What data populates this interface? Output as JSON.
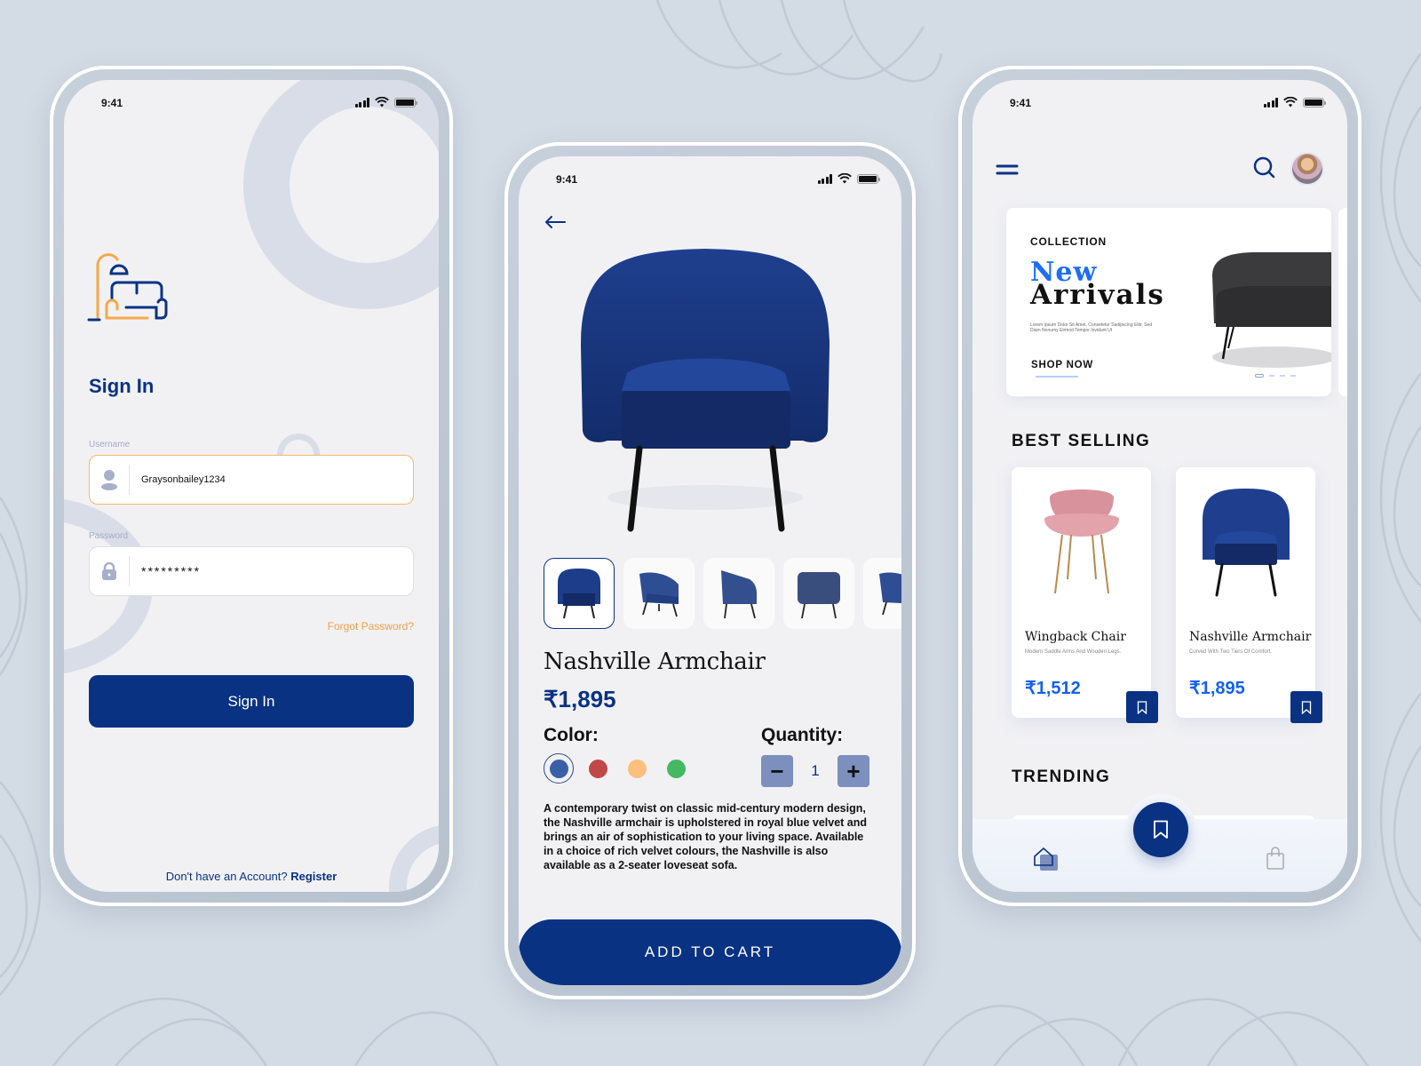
{
  "status_bar": {
    "time": "9:41"
  },
  "signin_screen": {
    "title": "Sign In",
    "username": {
      "label": "Username",
      "value": "Graysonbailey1234",
      "icon": "user-icon"
    },
    "password": {
      "label": "Password",
      "value": "*********",
      "icon": "lock-icon"
    },
    "forgot_password": "Forgot Password?",
    "signin_button": "Sign In",
    "register_prompt": "Don't have an Account?",
    "register_link": "Register",
    "logo": "furniture-logo-icon"
  },
  "product_screen": {
    "back_icon": "arrow-left-icon",
    "product_name": "Nashville Armchair",
    "price": "₹1,895",
    "color_label": "Color:",
    "colors": [
      {
        "name": "blue",
        "hex": "#3a5fa5",
        "selected": true
      },
      {
        "name": "red",
        "hex": "#c04848",
        "selected": false
      },
      {
        "name": "peach",
        "hex": "#fcbf7e",
        "selected": false
      },
      {
        "name": "green",
        "hex": "#45b862",
        "selected": false
      }
    ],
    "quantity_label": "Quantity:",
    "quantity": "1",
    "decrement": "−",
    "increment": "+",
    "thumbnails": [
      "front",
      "three-quarter",
      "side",
      "back",
      "partial"
    ],
    "description": "A contemporary twist on classic mid-century modern design, the Nashville armchair is upholstered in royal blue velvet and brings an air of sophistication to your living space. Available in a choice of rich velvet colours, the Nashville is also available as a 2-seater loveseat sofa.",
    "add_to_cart": "ADD TO CART"
  },
  "home_screen": {
    "menu_icon": "menu-icon",
    "search_icon": "search-icon",
    "banner": {
      "eyebrow": "COLLECTION",
      "title_accent": "New",
      "title_main": "Arrivals",
      "body": "Lorem Ipsum Dolor Sit Amet, Consetetur Sadipscing Elitr, Sed Diam Nonumy Eirmod Tempor Invidunt Ut",
      "cta": "SHOP NOW",
      "slide_count": 4,
      "active_slide": 1
    },
    "best_selling_title": "BEST SELLING",
    "products": [
      {
        "name": "Wingback Chair",
        "desc": "Modern Saddle Arms And Wooden Legs.",
        "price": "₹1,512"
      },
      {
        "name": "Nashville Armchair",
        "desc": "Curved With Two Tiers Of Comfort.",
        "price": "₹1,895"
      }
    ],
    "trending_title": "TRENDING",
    "tabs": [
      "home",
      "saved",
      "cart"
    ]
  },
  "colors": {
    "primary": "#0a3283",
    "accent_orange": "#f0a045",
    "accent_blue": "#1560f0",
    "background": "#d3dbe4",
    "screen": "#f1f1f4"
  }
}
